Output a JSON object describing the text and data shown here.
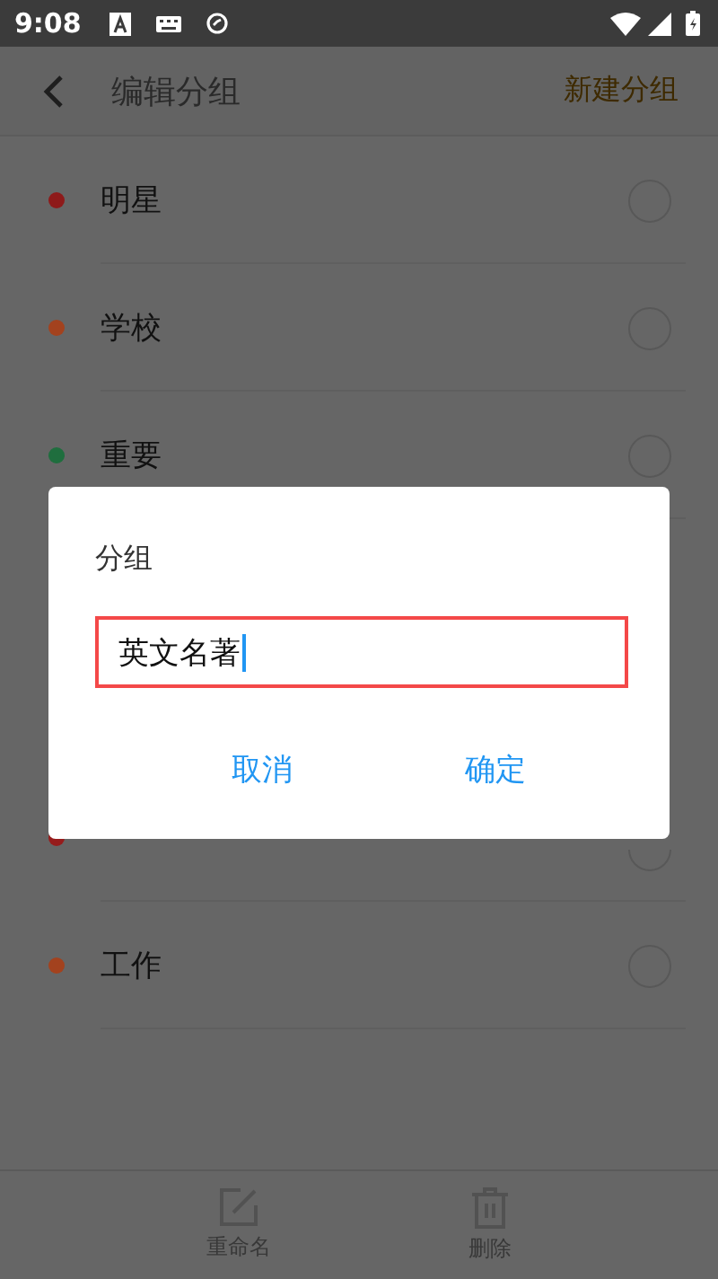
{
  "status_bar": {
    "time": "9:08"
  },
  "header": {
    "title": "编辑分组",
    "action": "新建分组"
  },
  "groups": [
    {
      "kind": "row",
      "label": "明星",
      "color": "#8e1a1a",
      "selected": false
    },
    {
      "kind": "row",
      "label": "学校",
      "color": "#a3421e",
      "selected": false
    },
    {
      "kind": "row",
      "label": "重要",
      "color": "#1f6e3e",
      "selected": false
    },
    {
      "kind": "covered",
      "color": "#961c1c",
      "selected": false
    },
    {
      "kind": "row",
      "label": "工作",
      "color": "#a3421e",
      "selected": false
    }
  ],
  "toolbar": [
    {
      "kind": "rename",
      "label": "重命名"
    },
    {
      "kind": "delete",
      "label": "删除"
    }
  ],
  "dialog": {
    "title": "分组",
    "value": "英文名著",
    "buttons": [
      {
        "label": "取消"
      },
      {
        "label": "确定"
      }
    ]
  }
}
